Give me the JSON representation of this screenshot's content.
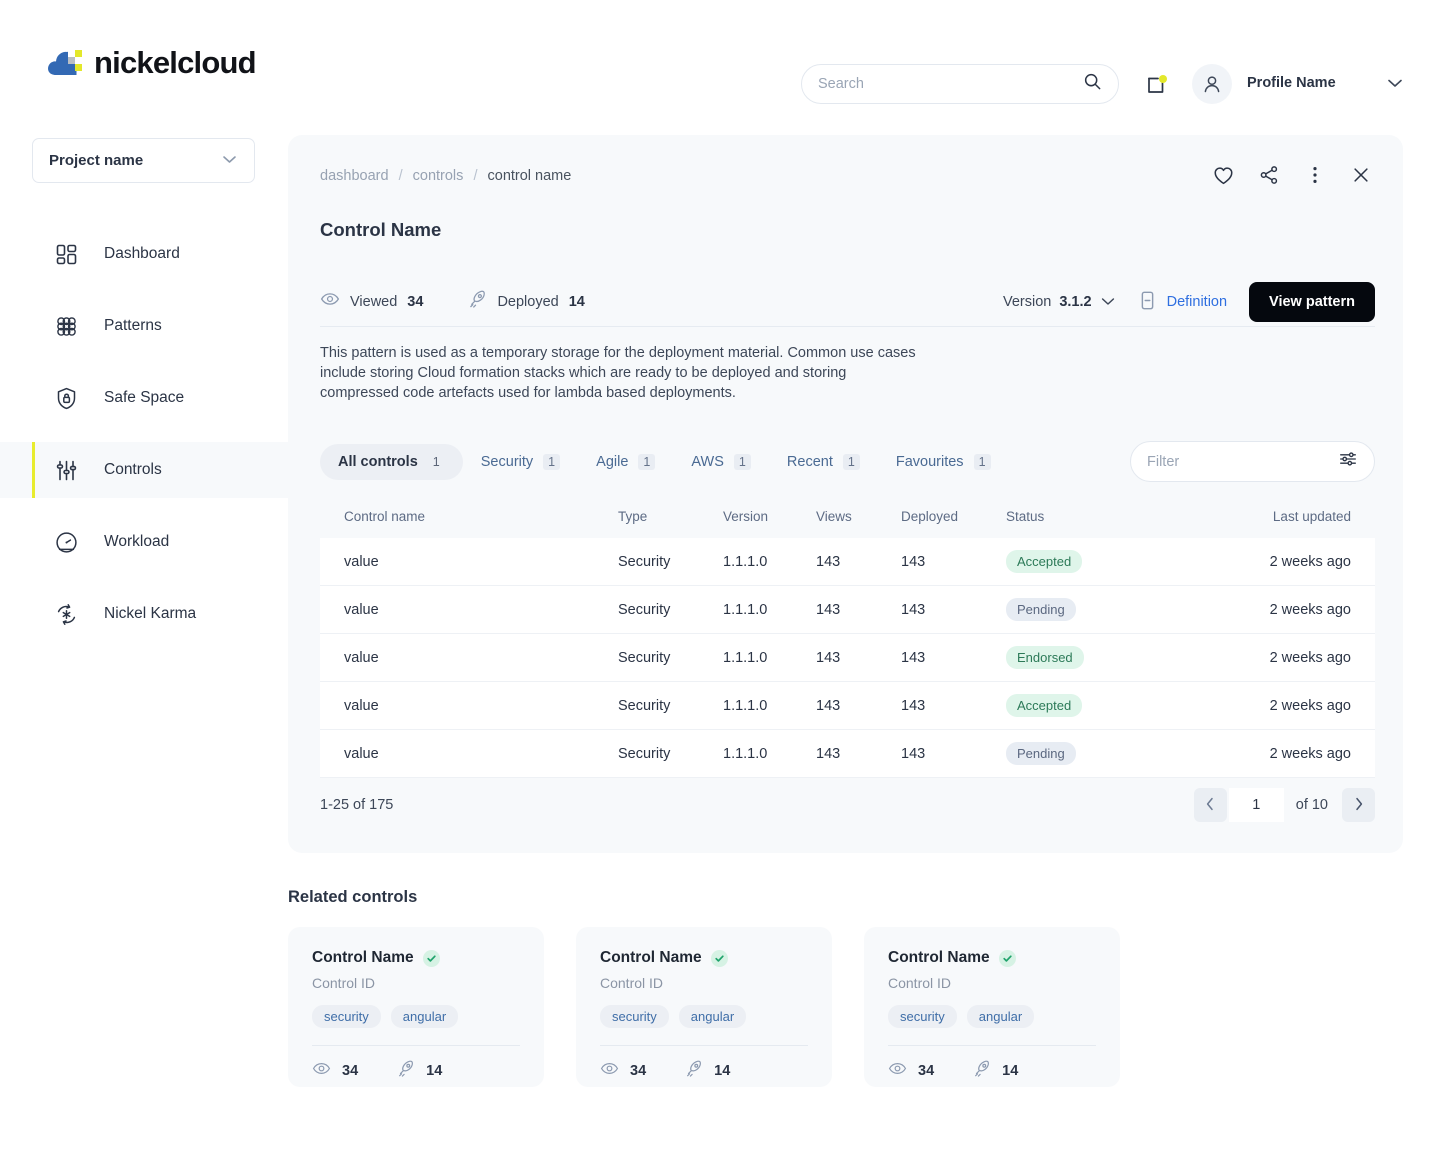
{
  "brand": {
    "name": "nickelcloud",
    "logo_icon": "cloud-checker-logo"
  },
  "header": {
    "search": {
      "placeholder": "Search",
      "value": "",
      "icon": "search-icon"
    },
    "notification": {
      "icon": "notification-square-icon",
      "has_badge": true,
      "badge_color": "#e3e82b"
    },
    "profile": {
      "name": "Profile Name",
      "avatar_icon": "user-avatar-icon",
      "caret_icon": "chevron-down-icon"
    }
  },
  "sidebar": {
    "project_select": {
      "label": "Project name",
      "caret_icon": "chevron-down-icon"
    },
    "items": [
      {
        "label": "Dashboard",
        "icon": "dashboard-grid-icon",
        "active": false
      },
      {
        "label": "Patterns",
        "icon": "patterns-hexgrid-icon",
        "active": false
      },
      {
        "label": "Safe Space",
        "icon": "shield-lock-icon",
        "active": false
      },
      {
        "label": "Controls",
        "icon": "sliders-vertical-icon",
        "active": true
      },
      {
        "label": "Workload",
        "icon": "gauge-icon",
        "active": false
      },
      {
        "label": "Nickel Karma",
        "icon": "karma-refresh-star-icon",
        "active": false
      }
    ],
    "active_accent": "#e8ec2e"
  },
  "panel": {
    "breadcrumb": {
      "items": [
        "dashboard",
        "controls",
        "control name"
      ],
      "separator": "/"
    },
    "actions": [
      {
        "name": "favourite",
        "icon": "heart-icon"
      },
      {
        "name": "share",
        "icon": "share-nodes-icon"
      },
      {
        "name": "more",
        "icon": "more-vertical-icon"
      },
      {
        "name": "close",
        "icon": "close-x-icon"
      }
    ],
    "title": "Control Name",
    "stats": [
      {
        "label": "Viewed",
        "value": "34",
        "icon": "eye-icon"
      },
      {
        "label": "Deployed",
        "value": "14",
        "icon": "rocket-icon"
      }
    ],
    "version": {
      "label": "Version",
      "value": "3.1.2",
      "caret_icon": "chevron-down-icon"
    },
    "definition": {
      "label": "Definition",
      "icon": "document-icon",
      "color": "#2f6fe0"
    },
    "view_pattern_button": "View pattern",
    "description": "This pattern is used as a temporary storage for the deployment material. Common use cases include storing Cloud formation stacks which are ready to be deployed and storing compressed code artefacts used for lambda based deployments.",
    "tabs": [
      {
        "label": "All controls",
        "count": "1",
        "active": true
      },
      {
        "label": "Security",
        "count": "1",
        "active": false
      },
      {
        "label": "Agile",
        "count": "1",
        "active": false
      },
      {
        "label": "AWS",
        "count": "1",
        "active": false
      },
      {
        "label": "Recent",
        "count": "1",
        "active": false
      },
      {
        "label": "Favourites",
        "count": "1",
        "active": false
      }
    ],
    "filter": {
      "placeholder": "Filter",
      "value": "",
      "icon": "sliders-horizontal-icon"
    }
  },
  "table": {
    "columns": [
      "Control name",
      "Type",
      "Version",
      "Views",
      "Deployed",
      "Status",
      "Last updated"
    ],
    "rows": [
      {
        "name": "value",
        "type": "Security",
        "version": "1.1.1.0",
        "views": "143",
        "deployed": "143",
        "status": "Accepted",
        "status_kind": "accepted",
        "updated": "2 weeks ago"
      },
      {
        "name": "value",
        "type": "Security",
        "version": "1.1.1.0",
        "views": "143",
        "deployed": "143",
        "status": "Pending",
        "status_kind": "pending",
        "updated": "2 weeks ago"
      },
      {
        "name": "value",
        "type": "Security",
        "version": "1.1.1.0",
        "views": "143",
        "deployed": "143",
        "status": "Endorsed",
        "status_kind": "endorsed",
        "updated": "2 weeks ago"
      },
      {
        "name": "value",
        "type": "Security",
        "version": "1.1.1.0",
        "views": "143",
        "deployed": "143",
        "status": "Accepted",
        "status_kind": "accepted",
        "updated": "2 weeks ago"
      },
      {
        "name": "value",
        "type": "Security",
        "version": "1.1.1.0",
        "views": "143",
        "deployed": "143",
        "status": "Pending",
        "status_kind": "pending",
        "updated": "2 weeks ago"
      }
    ]
  },
  "pagination": {
    "summary": "1-25 of 175",
    "page_value": "1",
    "of_label": "of 10",
    "prev_icon": "chevron-left-icon",
    "next_icon": "chevron-right-icon"
  },
  "related": {
    "title": "Related controls",
    "cards": [
      {
        "title": "Control Name",
        "verified_icon": "check-circle-icon",
        "subtitle": "Control ID",
        "tags": [
          "security",
          "angular"
        ],
        "views": "34",
        "deploys": "14",
        "views_icon": "eye-icon",
        "deploys_icon": "rocket-icon"
      },
      {
        "title": "Control Name",
        "verified_icon": "check-circle-icon",
        "subtitle": "Control ID",
        "tags": [
          "security",
          "angular"
        ],
        "views": "34",
        "deploys": "14",
        "views_icon": "eye-icon",
        "deploys_icon": "rocket-icon"
      },
      {
        "title": "Control Name",
        "verified_icon": "check-circle-icon",
        "subtitle": "Control ID",
        "tags": [
          "security",
          "angular"
        ],
        "views": "34",
        "deploys": "14",
        "views_icon": "eye-icon",
        "deploys_icon": "rocket-icon"
      }
    ]
  },
  "colors": {
    "accent_yellow": "#e8ec2e",
    "link_blue": "#2f6fe0",
    "panel_bg": "#f7f9fb",
    "status_accepted_bg": "#dff5ea",
    "status_accepted_fg": "#2c7a58",
    "status_pending_bg": "#e7ecf3",
    "status_pending_fg": "#5b6880",
    "button_black": "#05080e"
  }
}
